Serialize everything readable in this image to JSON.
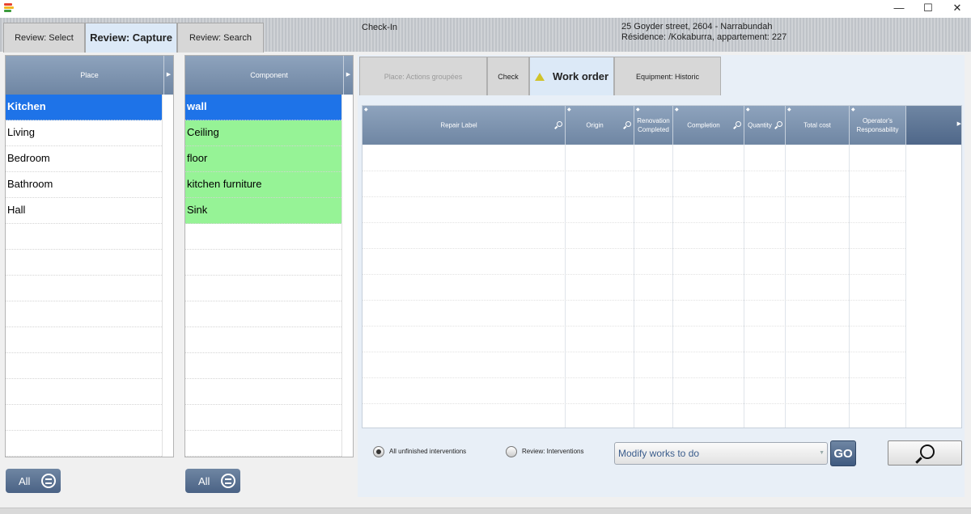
{
  "window": {
    "minimize": "—",
    "maximize": "☐",
    "close": "✕",
    "logo_colors": [
      "#e8442f",
      "#f2b823",
      "#3c9b3c",
      "#2f7bd9"
    ]
  },
  "header": {
    "tabs": [
      {
        "label": "Review: Select"
      },
      {
        "label": "Review: Capture"
      },
      {
        "label": "Review: Search"
      }
    ],
    "module": "Check-In",
    "address_line1": "25 Goyder street, 2604 - Narrabundah",
    "address_line2": "Résidence: /Kokaburra, appartement: 227"
  },
  "place_panel": {
    "header": "Place",
    "items": [
      "Kitchen",
      "Living",
      "Bedroom",
      "Bathroom",
      "Hall"
    ],
    "all_label": "All"
  },
  "component_panel": {
    "header": "Component",
    "items": [
      "wall",
      "Ceiling",
      "floor",
      "kitchen furniture",
      "Sink"
    ],
    "all_label": "All"
  },
  "main": {
    "tabs": [
      {
        "label": "Place: Actions groupées",
        "state": "disabled"
      },
      {
        "label": "Check",
        "state": "normal"
      },
      {
        "label": "Work order",
        "state": "active"
      },
      {
        "label": "Equipment: Historic",
        "state": "normal"
      }
    ],
    "grid": {
      "columns": [
        {
          "label": "Repair Label"
        },
        {
          "label": "Origin"
        },
        {
          "label": "Renovation Completed"
        },
        {
          "label": "Completion"
        },
        {
          "label": "Quantity"
        },
        {
          "label": "Total cost"
        },
        {
          "label": "Operator's Responsability"
        }
      ]
    },
    "radio_all_unfinished": "All unfinished interventions",
    "radio_review": "Review: Interventions",
    "works_select": "Modify works to do",
    "go_label": "GO"
  },
  "colors": {
    "header_blue": "#7a90ad",
    "selected_blue": "#1e73e8",
    "green_row": "#96f396"
  }
}
